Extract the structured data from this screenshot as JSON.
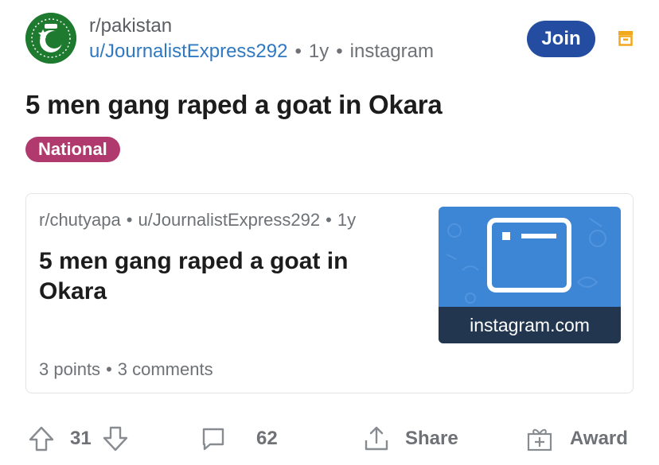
{
  "post": {
    "subreddit": "r/pakistan",
    "author": "u/JournalistExpress292",
    "age": "1y",
    "source": "instagram",
    "join_label": "Join",
    "title": "5 men gang raped a goat in Okara",
    "flair": "National"
  },
  "crosspost": {
    "subreddit": "r/chutyapa",
    "author": "u/JournalistExpress292",
    "age": "1y",
    "title": "5 men gang raped a goat in Okara",
    "points": "3 points",
    "comments": "3 comments",
    "thumbnail_caption": "instagram.com"
  },
  "actions": {
    "votes": "31",
    "comments": "62",
    "share_label": "Share",
    "award_label": "Award"
  },
  "separator": "•",
  "colors": {
    "join_button": "#244da1",
    "flair": "#b03a6d",
    "username": "#2f79c2",
    "save_icon": "#f2a81d",
    "thumbnail": "#3d86d6"
  },
  "icons": [
    "subreddit-avatar-icon",
    "save-icon",
    "link-thumbnail-icon",
    "upvote-icon",
    "downvote-icon",
    "comment-icon",
    "share-icon",
    "award-icon"
  ]
}
